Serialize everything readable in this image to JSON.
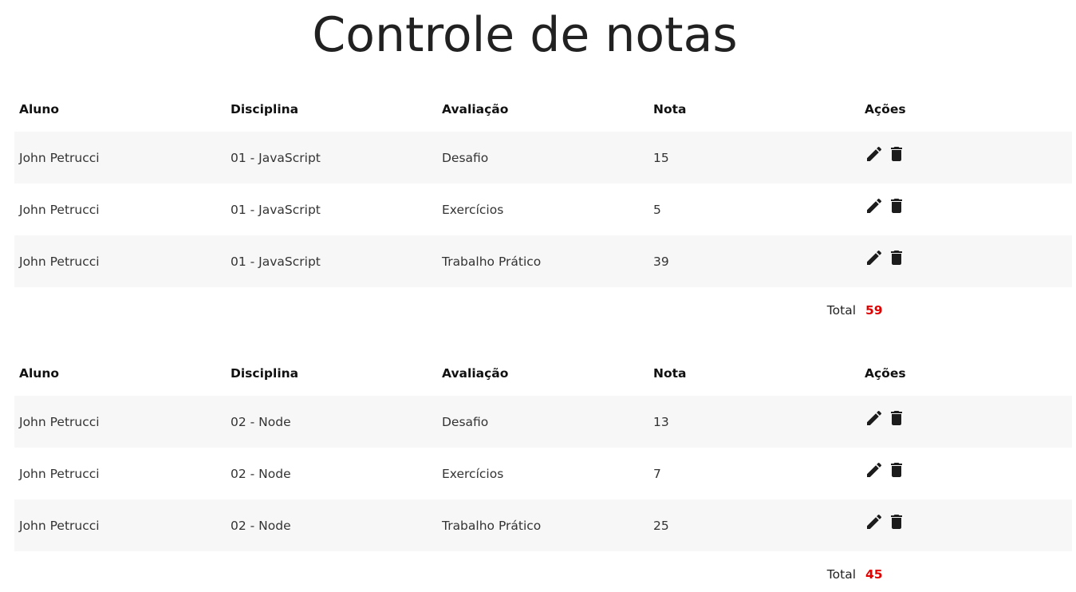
{
  "title": "Controle de notas",
  "columns": {
    "aluno": "Aluno",
    "disciplina": "Disciplina",
    "avaliacao": "Avaliação",
    "nota": "Nota",
    "acoes": "Ações"
  },
  "total_label": "Total",
  "groups": [
    {
      "rows": [
        {
          "aluno": "John Petrucci",
          "disciplina": "01 - JavaScript",
          "avaliacao": "Desafio",
          "nota": "15"
        },
        {
          "aluno": "John Petrucci",
          "disciplina": "01 - JavaScript",
          "avaliacao": "Exercícios",
          "nota": "5"
        },
        {
          "aluno": "John Petrucci",
          "disciplina": "01 - JavaScript",
          "avaliacao": "Trabalho Prático",
          "nota": "39"
        }
      ],
      "total": "59"
    },
    {
      "rows": [
        {
          "aluno": "John Petrucci",
          "disciplina": "02 - Node",
          "avaliacao": "Desafio",
          "nota": "13"
        },
        {
          "aluno": "John Petrucci",
          "disciplina": "02 - Node",
          "avaliacao": "Exercícios",
          "nota": "7"
        },
        {
          "aluno": "John Petrucci",
          "disciplina": "02 - Node",
          "avaliacao": "Trabalho Prático",
          "nota": "25"
        }
      ],
      "total": "45"
    }
  ],
  "icons": {
    "edit": "edit-icon",
    "delete": "delete-icon"
  },
  "colors": {
    "total_value": "#e00000",
    "row_stripe": "#f7f7f7",
    "text": "#212121"
  }
}
